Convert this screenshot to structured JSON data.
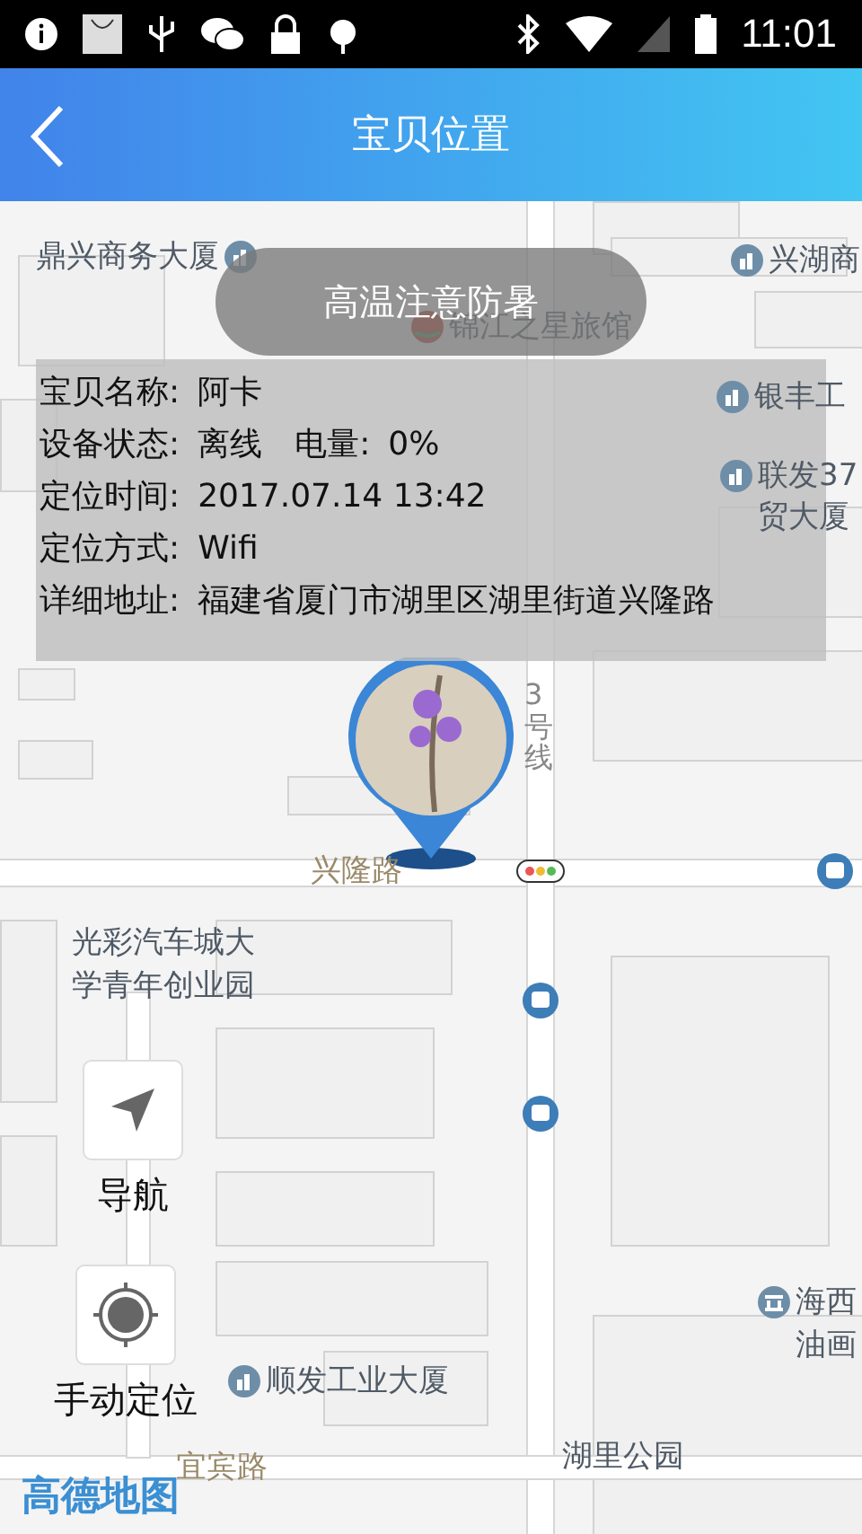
{
  "status_bar": {
    "time": "11:01"
  },
  "header": {
    "title": "宝贝位置"
  },
  "banner": {
    "text": "高温注意防暑"
  },
  "info_rows": [
    {
      "label": "宝贝名称:",
      "value": "阿卡"
    },
    {
      "label": "设备状态:",
      "value": "离线",
      "extra_label": "电量:",
      "extra_value": "0%"
    },
    {
      "label": "定位时间:",
      "value": "2017.07.14 13:42"
    },
    {
      "label": "定位方式:",
      "value": "Wifi"
    },
    {
      "label": "详细地址:",
      "value": "福建省厦门市湖里区湖里街道兴隆路"
    }
  ],
  "map_labels": [
    {
      "text": "鼎兴商务大厦",
      "kind": "poi_after"
    },
    {
      "text": "兴湖商",
      "kind": "poi"
    },
    {
      "text": "锦江之星旅馆",
      "kind": "hotel"
    },
    {
      "text": "银丰工",
      "kind": "poi"
    },
    {
      "text": "联发37",
      "kind": "poi"
    },
    {
      "text": "贸大厦",
      "kind": "place"
    },
    {
      "text": "3号线",
      "kind": "vertical"
    },
    {
      "text": "兴隆路",
      "kind": "road"
    },
    {
      "text": "光彩汽车城大",
      "kind": "place"
    },
    {
      "text": "学青年创业园",
      "kind": "place"
    },
    {
      "text": "顺发工业大厦",
      "kind": "poi"
    },
    {
      "text": "海西",
      "kind": "museum"
    },
    {
      "text": "油画",
      "kind": "place"
    },
    {
      "text": "宜宾路",
      "kind": "road"
    },
    {
      "text": "湖里公园",
      "kind": "place"
    }
  ],
  "map_logo": "高德地图",
  "controls": [
    {
      "label": "导航",
      "kind": "navigate"
    },
    {
      "label": "手动定位",
      "kind": "locate"
    }
  ]
}
